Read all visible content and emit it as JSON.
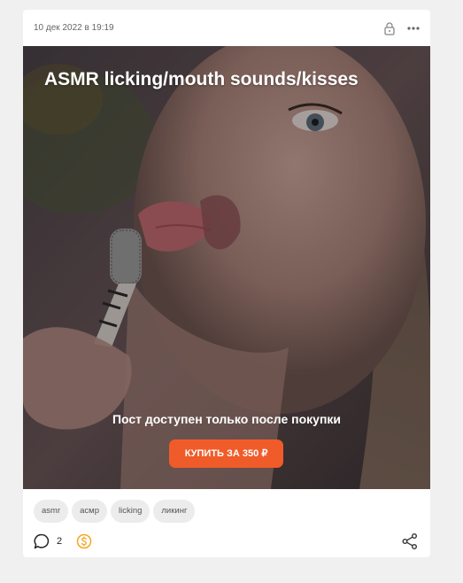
{
  "post": {
    "date": "10 дек 2022 в 19:19",
    "title": "ASMR licking/mouth sounds/kisses",
    "locked_message": "Пост доступен только после покупки",
    "buy_label": "КУПИТЬ ЗА 350 ₽",
    "tags": [
      "asmr",
      "асмр",
      "licking",
      "ликинг"
    ],
    "comments_count": "2"
  },
  "icons": {
    "lock": "lock-icon",
    "more": "more-dots-icon",
    "comment": "comment-bubble-icon",
    "donate": "dollar-coin-icon",
    "share": "share-icon"
  },
  "colors": {
    "accent": "#f05b2a",
    "donate": "#f5a623",
    "tag_bg": "#ececec"
  }
}
